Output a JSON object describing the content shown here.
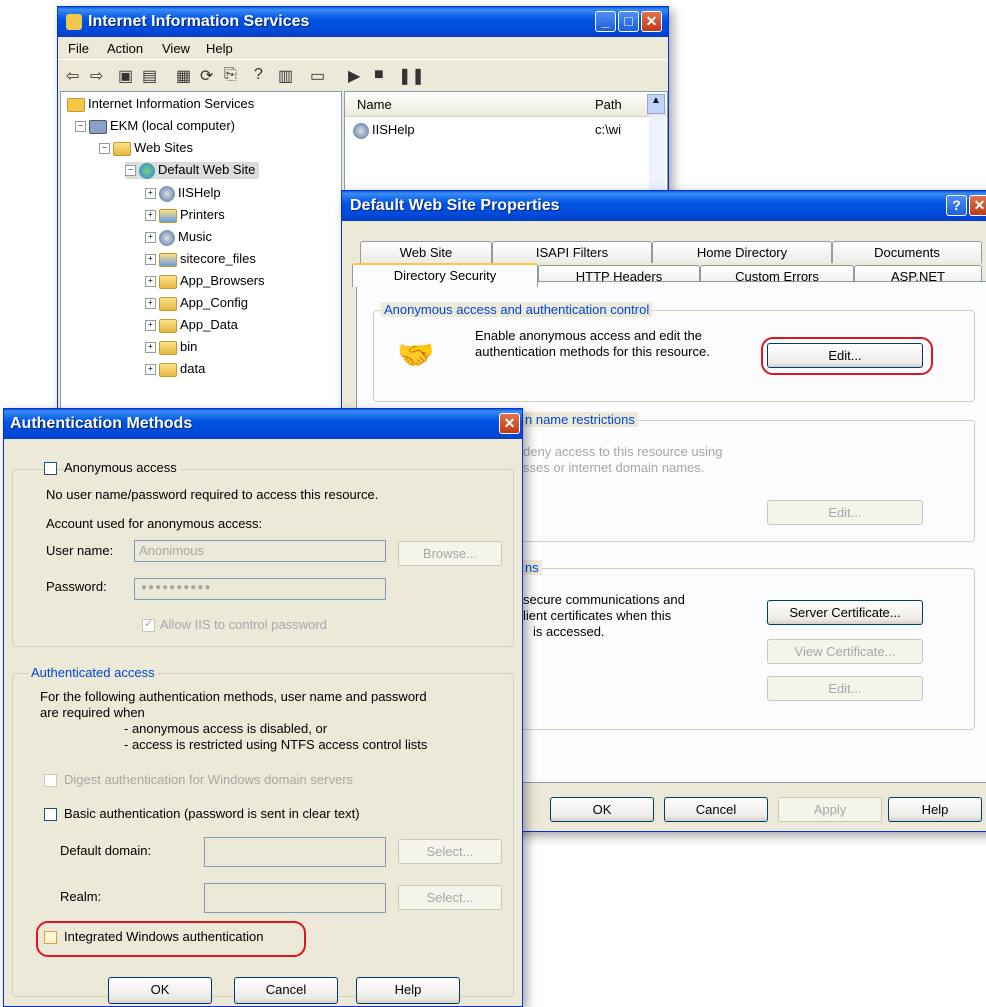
{
  "iis": {
    "title": "Internet Information Services",
    "menu": [
      "File",
      "Action",
      "View",
      "Help"
    ],
    "tree": {
      "root": "Internet Information Services",
      "computer": "EKM (local computer)",
      "web_sites": "Web Sites",
      "default_site": "Default Web Site",
      "children": [
        "IISHelp",
        "Printers",
        "Music",
        "sitecore_files",
        "App_Browsers",
        "App_Config",
        "App_Data",
        "bin",
        "data"
      ]
    },
    "list": {
      "col_name": "Name",
      "col_path": "Path",
      "rows": [
        {
          "name": "IISHelp",
          "path": "c:\\wi"
        }
      ]
    }
  },
  "props": {
    "title": "Default Web Site Properties",
    "tabs_back": [
      "Web Site",
      "ISAPI Filters",
      "Home Directory",
      "Documents"
    ],
    "tabs_front": [
      "Directory Security",
      "HTTP Headers",
      "Custom Errors",
      "ASP.NET"
    ],
    "anon_group": "Anonymous access and authentication control",
    "anon_desc_1": "Enable anonymous access and edit the",
    "anon_desc_2": "authentication methods for this resource.",
    "edit_label": "Edit...",
    "ip_group": "n name restrictions",
    "ip_desc_1": "deny access to this resource using",
    "ip_desc_2": "sses or internet domain names.",
    "sec_group": "ns",
    "sec_desc_1": "secure communications and",
    "sec_desc_2": "lient certificates when this",
    "sec_desc_3": "is accessed.",
    "server_cert": "Server Certificate...",
    "view_cert": "View Certificate...",
    "ok": "OK",
    "cancel": "Cancel",
    "apply": "Apply",
    "help": "Help"
  },
  "auth": {
    "title": "Authentication Methods",
    "anon_access": "Anonymous access",
    "no_user": "No user name/password required to access this resource.",
    "account_used": "Account used for anonymous access:",
    "user_name_label": "User name:",
    "user_name_value": "Anonimous",
    "browse": "Browse...",
    "password_label": "Password:",
    "password_value": "●●●●●●●●●●",
    "allow_iis": "Allow IIS to control password",
    "auth_access": "Authenticated access",
    "desc_1": "For the following authentication methods, user name and password",
    "desc_2": "are required when",
    "desc_3": "- anonymous access is disabled, or",
    "desc_4": "- access is restricted using NTFS access control lists",
    "digest": "Digest authentication for Windows domain servers",
    "basic": "Basic authentication (password is sent in clear text)",
    "default_domain": "Default domain:",
    "realm": "Realm:",
    "select": "Select...",
    "integrated": "Integrated Windows authentication",
    "ok": "OK",
    "cancel": "Cancel",
    "help": "Help"
  }
}
